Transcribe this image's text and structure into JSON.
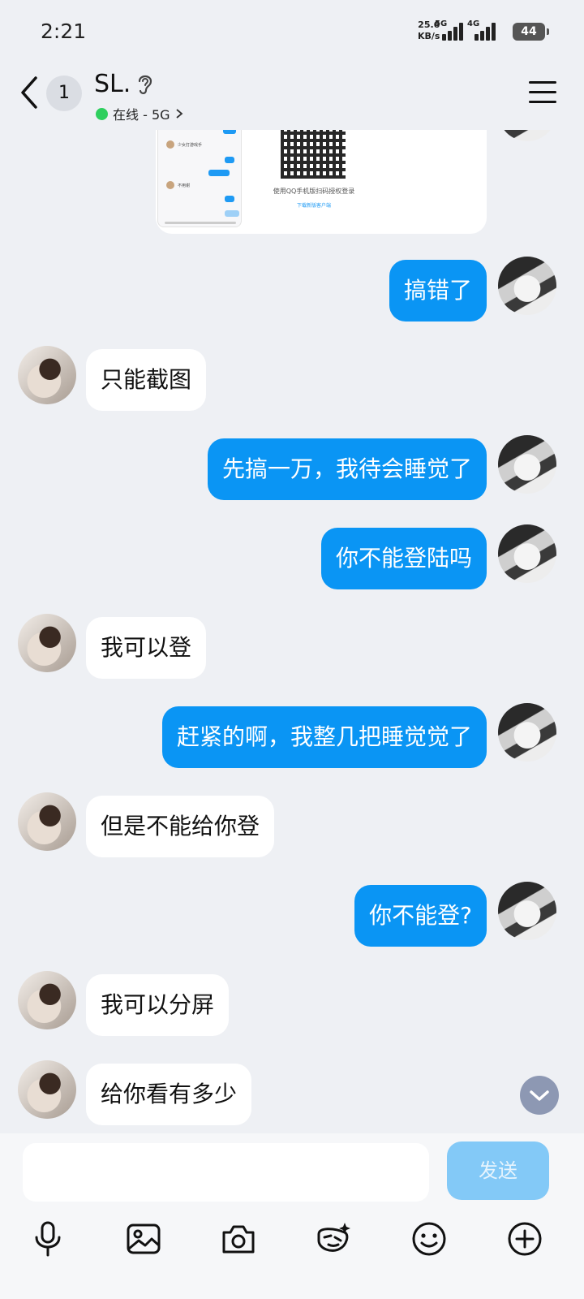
{
  "status_bar": {
    "time": "2:21",
    "net_speed": "25.6",
    "net_unit": "KB/s",
    "sim1": "5G",
    "sim2": "4G",
    "battery": "44"
  },
  "header": {
    "unread_count": "1",
    "title": "SL.",
    "presence": "在线 - 5G",
    "presence_color": "#2ecf5e"
  },
  "shared_image": {
    "qr_caption": "使用QQ手机版扫码授权登录",
    "qr_link": "下载新版客户端",
    "mini_chat_line_1": "少女打游戏手",
    "mini_chat_line_2": "不用谢"
  },
  "messages": [
    {
      "side": "out",
      "text": "搞错了"
    },
    {
      "side": "in",
      "text": "只能截图"
    },
    {
      "side": "out",
      "text": "先搞一万，我待会睡觉了"
    },
    {
      "side": "out",
      "text": "你不能登陆吗"
    },
    {
      "side": "in",
      "text": "我可以登"
    },
    {
      "side": "out",
      "text": "赶紧的啊，我整几把睡觉觉了"
    },
    {
      "side": "in",
      "text": "但是不能给你登"
    },
    {
      "side": "out",
      "text": "你不能登?"
    },
    {
      "side": "in",
      "text": "我可以分屏"
    },
    {
      "side": "in",
      "text": "给你看有多少"
    }
  ],
  "composer": {
    "input_value": "",
    "send_label": "发送",
    "tools": [
      "microphone-icon",
      "image-icon",
      "camera-icon",
      "sticker-icon",
      "emoji-icon",
      "plus-icon"
    ]
  },
  "colors": {
    "outgoing_bubble": "#0a95f4",
    "incoming_bubble": "#ffffff",
    "background": "#eef0f4",
    "send_disabled": "#83c9f7"
  }
}
